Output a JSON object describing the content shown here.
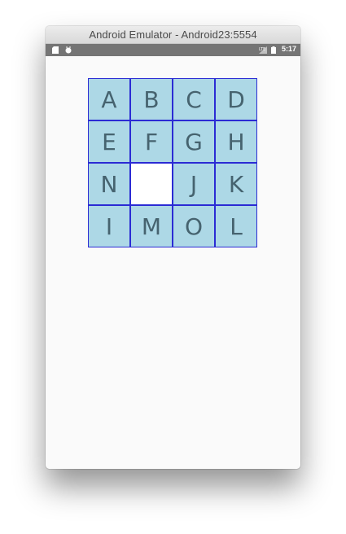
{
  "window": {
    "title": "Android Emulator - Android23:5554"
  },
  "status_bar": {
    "time": "5:17",
    "left_icons": [
      "sd-card-icon",
      "android-debug-icon"
    ],
    "right_icons": [
      "no-signal-icon",
      "battery-icon"
    ]
  },
  "puzzle": {
    "tile_color": "#add8e6",
    "border_color": "#2b2bd4",
    "empty_color": "#ffffff",
    "rows": [
      [
        "A",
        "B",
        "C",
        "D"
      ],
      [
        "E",
        "F",
        "G",
        "H"
      ],
      [
        "N",
        "",
        "J",
        "K"
      ],
      [
        "I",
        "M",
        "O",
        "L"
      ]
    ]
  }
}
